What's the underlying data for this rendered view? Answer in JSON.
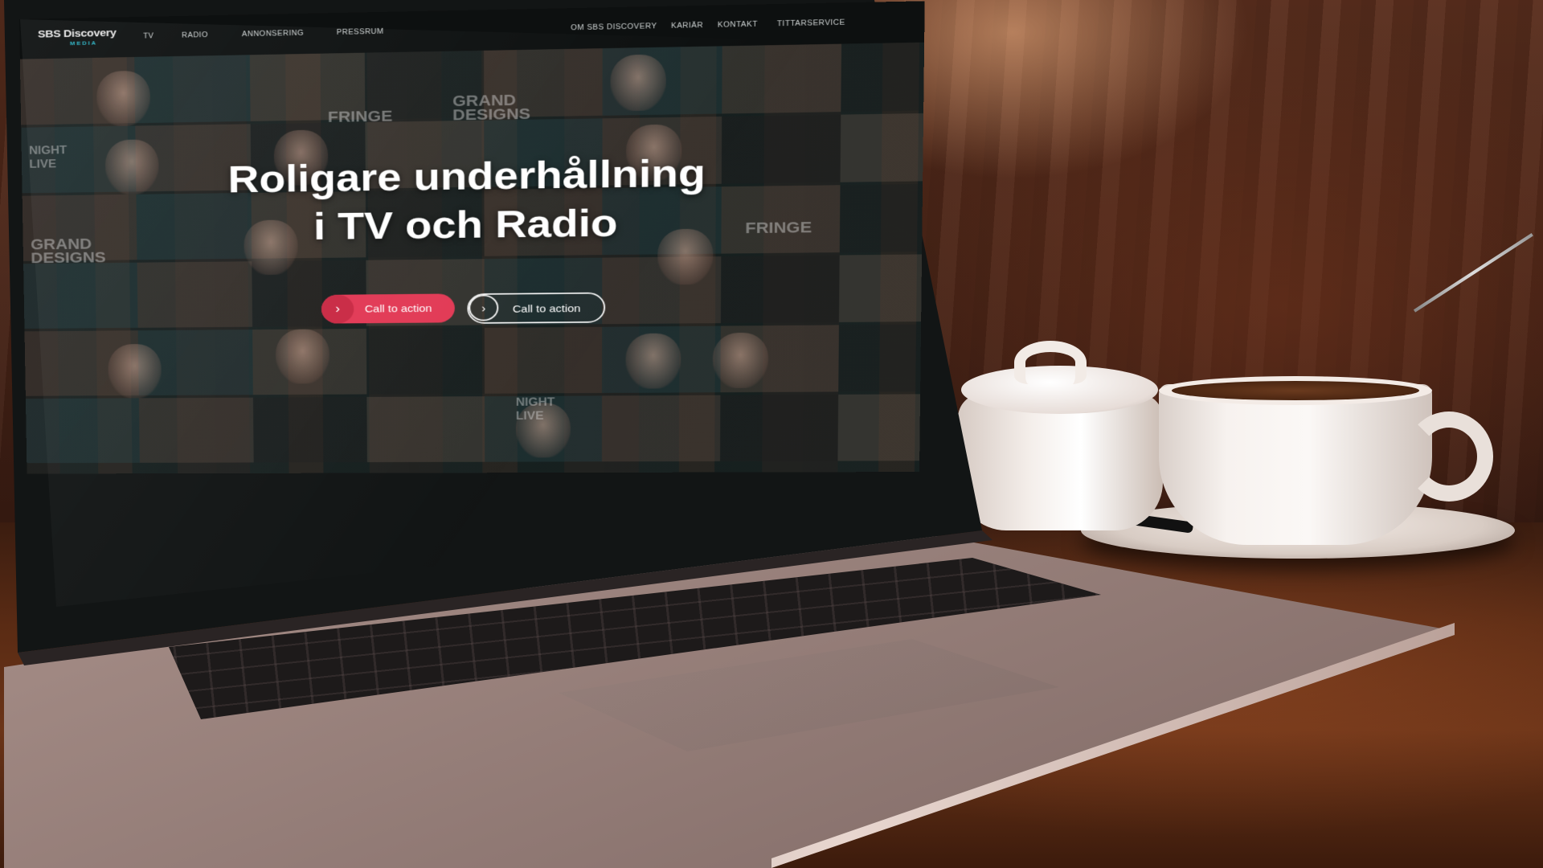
{
  "site": {
    "logo": {
      "main": "SBS Discovery",
      "sub": "MEDIA"
    },
    "nav_left": [
      "TV",
      "RADIO",
      "ANNONSERING",
      "PRESSRUM"
    ],
    "nav_right": [
      "OM SBS DISCOVERY",
      "KARIÄR",
      "KONTAKT",
      "TITTARSERVICE"
    ],
    "hero": {
      "title_line1": "Roligare underhållning",
      "title_line2": "i TV och Radio",
      "cta_primary": "Call to action",
      "cta_secondary": "Call to action",
      "tile_labels": [
        "GRAND DESIGNS",
        "FRINGE",
        "NIGHT LIVE",
        "GRAND DESIGNS",
        "FRINGE",
        "NIGHT LIVE"
      ]
    }
  },
  "colors": {
    "accent": "#e23a56",
    "logo_sub": "#2bb6c8",
    "nav_bg": "#0d1010"
  },
  "icons": {
    "cta_primary": "chevron-right-icon",
    "cta_secondary": "chevron-right-icon"
  }
}
